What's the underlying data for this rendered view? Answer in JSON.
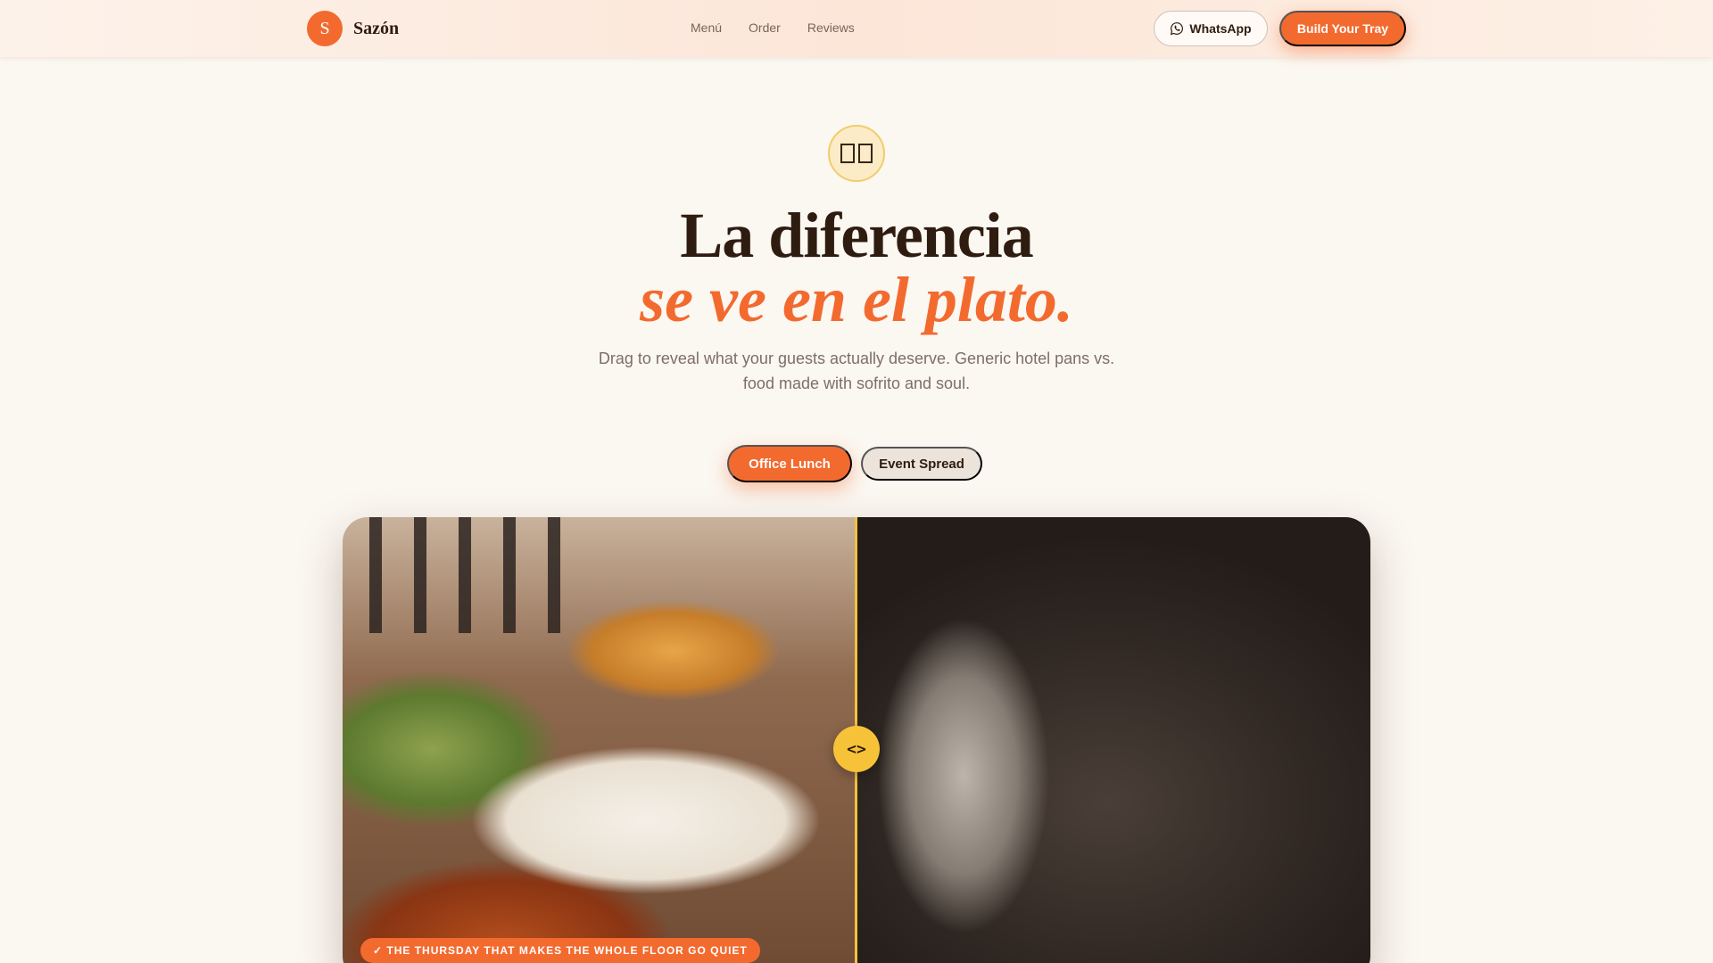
{
  "brand": {
    "initial": "S",
    "name": "Sazón",
    "accent": "#f36a2f",
    "highlight": "#f6c338"
  },
  "nav": {
    "links": [
      "Menú",
      "Order",
      "Reviews"
    ],
    "whatsapp_label": "WhatsApp",
    "whatsapp_icon": "whatsapp-icon",
    "cta_label": "Build Your Tray"
  },
  "hero": {
    "icon": "split-compare-icon",
    "title_line1": "La diferencia",
    "title_line2": "se ve en el plato.",
    "subtitle": "Drag to reveal what your guests actually deserve. Generic hotel pans vs. food made with sofrito and soul."
  },
  "toggle": {
    "options": [
      "Office Lunch",
      "Event Spread"
    ],
    "selected": "Office Lunch"
  },
  "comparison": {
    "left_image": "latin-food-spread",
    "right_image": "generic-hotel-pan",
    "handle_icon": "drag-handle-icon",
    "handle_glyph": "<>",
    "reveal_fraction": 0.5,
    "caption": "✓ THE THURSDAY THAT MAKES THE WHOLE FLOOR GO QUIET"
  }
}
